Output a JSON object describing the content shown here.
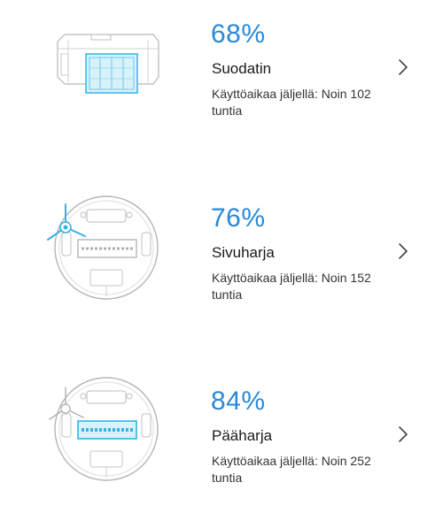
{
  "accent_color": "#2a89d8",
  "consumables": [
    {
      "percent": "68%",
      "name": "Suodatin",
      "remaining_line1": "Käyttöaikaa jäljellä: Noin 102",
      "remaining_line2": "tuntia",
      "level": 0.68,
      "icon": "filter-icon"
    },
    {
      "percent": "76%",
      "name": "Sivuharja",
      "remaining_line1": "Käyttöaikaa jäljellä: Noin 152",
      "remaining_line2": "tuntia",
      "level": 0.76,
      "icon": "side-brush-icon"
    },
    {
      "percent": "84%",
      "name": "Pääharja",
      "remaining_line1": "Käyttöaikaa jäljellä: Noin 252",
      "remaining_line2": "tuntia",
      "level": 0.84,
      "icon": "main-brush-icon"
    }
  ]
}
